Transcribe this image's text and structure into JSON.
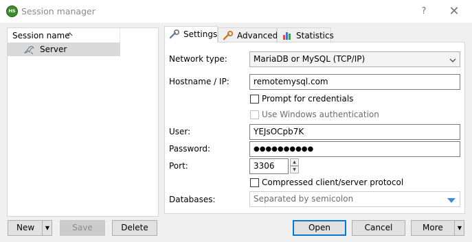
{
  "window": {
    "title": "Session manager",
    "app_icon_text": "HS",
    "help_label": "?",
    "close_label": "✕"
  },
  "session_tree": {
    "column_header": "Session name",
    "sort_icon": "chevron-up-icon",
    "sessions": [
      {
        "name": "Server",
        "icon": "dolphin-icon",
        "selected": true
      }
    ]
  },
  "tabs": [
    {
      "label": "Settings",
      "icon": "wrench-icon",
      "active": true
    },
    {
      "label": "Advanced",
      "icon": "wrench-orange-icon",
      "active": false
    },
    {
      "label": "Statistics",
      "icon": "bar-chart-icon",
      "active": false
    }
  ],
  "settings": {
    "network_type_label": "Network type:",
    "network_type_value": "MariaDB or MySQL (TCP/IP)",
    "hostname_label": "Hostname / IP:",
    "hostname_value": "remotemysql.com",
    "prompt_credentials_label": "Prompt for credentials",
    "prompt_credentials_checked": false,
    "windows_auth_label": "Use Windows authentication",
    "windows_auth_checked": false,
    "windows_auth_enabled": false,
    "user_label": "User:",
    "user_value": "YEJsOCpb7K",
    "password_label": "Password:",
    "password_value": "●●●●●●●●●●",
    "port_label": "Port:",
    "port_value": "3306",
    "compressed_label": "Compressed client/server protocol",
    "compressed_checked": false,
    "databases_label": "Databases:",
    "databases_placeholder": "Separated by semicolon"
  },
  "buttons": {
    "new_label": "New",
    "save_label": "Save",
    "delete_label": "Delete",
    "open_label": "Open",
    "cancel_label": "Cancel",
    "more_label": "More"
  },
  "colors": {
    "accent_blue": "#0078d7",
    "selected_row": "#d9d9d9",
    "dropdown_arrow_blue": "#3c8be0"
  }
}
